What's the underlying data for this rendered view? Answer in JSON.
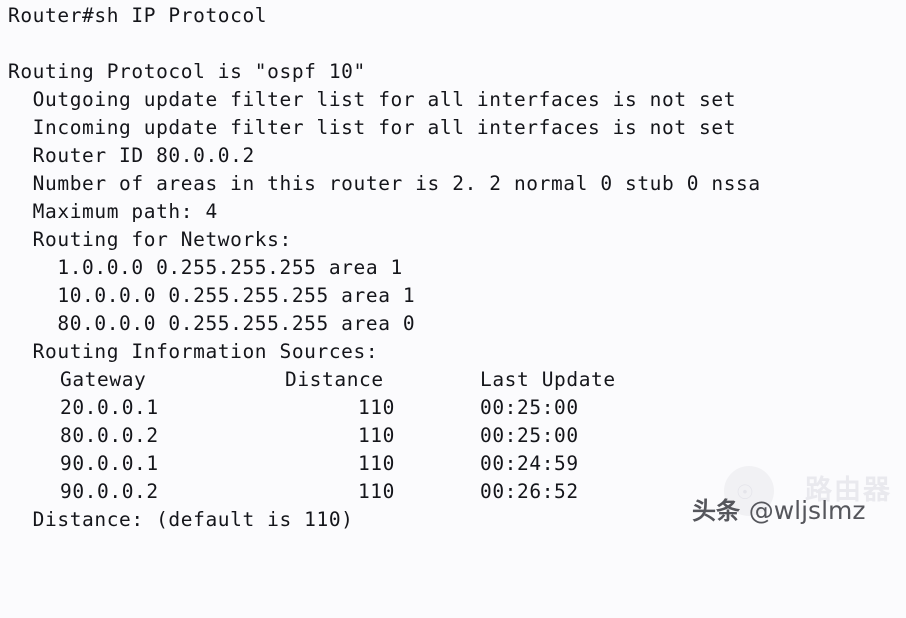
{
  "terminal": {
    "background_color": "#fbfbfd",
    "text_color": "#14151a",
    "prompt_line": "Router#sh IP Protocol",
    "blank_line": "",
    "lines": [
      "Routing Protocol is \"ospf 10\"",
      "  Outgoing update filter list for all interfaces is not set",
      "  Incoming update filter list for all interfaces is not set",
      "  Router ID 80.0.0.2",
      "  Number of areas in this router is 2. 2 normal 0 stub 0 nssa",
      "  Maximum path: 4",
      "  Routing for Networks:"
    ],
    "networks": [
      "    1.0.0.0 0.255.255.255 area 1",
      "    10.0.0.0 0.255.255.255 area 1",
      "    80.0.0.0 0.255.255.255 area 0"
    ],
    "sources_header": "  Routing Information Sources:",
    "table": {
      "headers": {
        "gateway": "Gateway",
        "distance": "Distance",
        "last_update": "Last Update"
      },
      "rows": [
        {
          "gateway": "20.0.0.1",
          "distance": "110",
          "last_update": "00:25:00"
        },
        {
          "gateway": "80.0.0.2",
          "distance": "110",
          "last_update": "00:25:00"
        },
        {
          "gateway": "90.0.0.1",
          "distance": "110",
          "last_update": "00:24:59"
        },
        {
          "gateway": "90.0.0.2",
          "distance": "110",
          "last_update": "00:26:52"
        }
      ]
    },
    "footer_line": "  Distance: (default is 110)"
  },
  "watermark": {
    "ghost_text": "路由器",
    "brand_cn": "头条",
    "handle": "@wljslmz",
    "ghost_color": "#e9e9ee",
    "text_color": "#55565c"
  }
}
